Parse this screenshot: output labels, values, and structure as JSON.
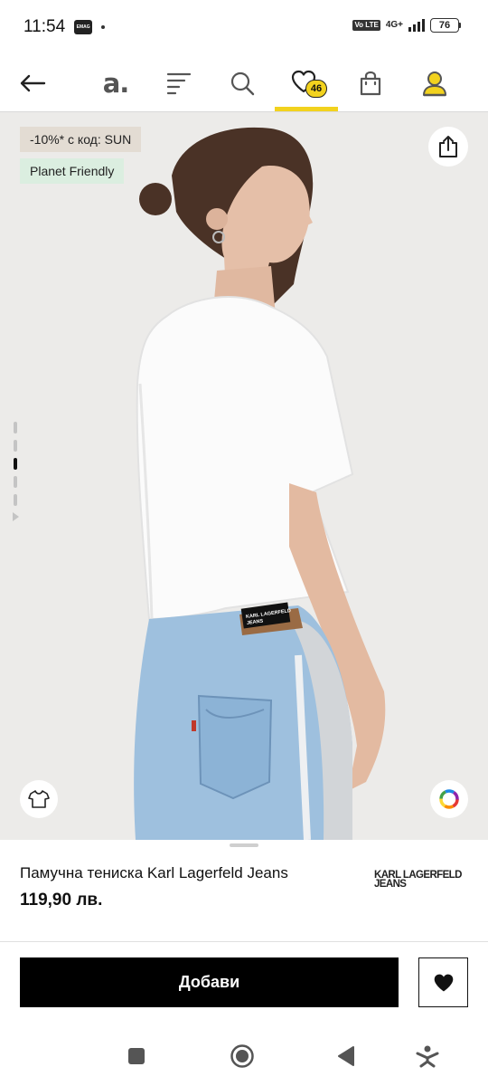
{
  "status_bar": {
    "time": "11:54",
    "app_icon_label": "EMAG",
    "volte": "Vo LTE",
    "network": "4G+",
    "battery": "76"
  },
  "top_nav": {
    "brand_logo": "a.",
    "wishlist_count": "46",
    "accent_color": "#f2d21e"
  },
  "product": {
    "tags": {
      "discount": "-10%* с код: SUN",
      "eco": "Planet Friendly"
    },
    "title": "Памучна тениска Karl Lagerfeld Jeans",
    "price": "119,90 лв.",
    "brand_logo_line1": "KARL LAGERFELD",
    "brand_logo_line2": "JEANS",
    "label_on_shirt_line1": "KARL LAGERFELD",
    "label_on_shirt_line2": "JEANS"
  },
  "gallery": {
    "slide_count": 6,
    "active_slide": 3
  },
  "actions": {
    "add_label": "Добави"
  },
  "icons": {
    "back": "arrow-left-icon",
    "menu": "menu-lines-icon",
    "search": "search-icon",
    "wishlist": "heart-icon",
    "bag": "shopping-bag-icon",
    "account": "user-icon",
    "share": "share-icon",
    "fit": "tshirt-icon",
    "color": "color-wheel-icon"
  }
}
